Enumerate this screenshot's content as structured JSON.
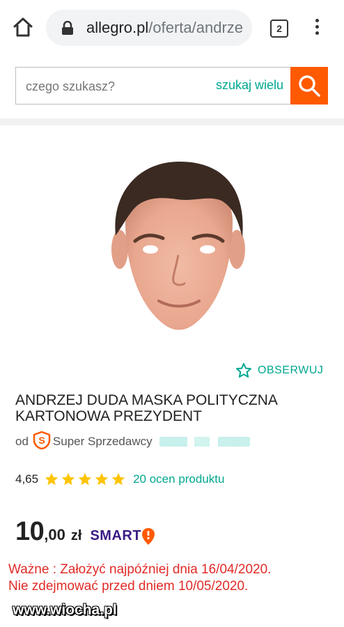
{
  "browser": {
    "url_domain": "allegro.pl",
    "url_path": "/oferta/andrze",
    "tab_count": "2"
  },
  "search": {
    "placeholder": "czego szukasz?",
    "search_many_label": "szukaj wielu"
  },
  "product": {
    "observe_label": "OBSERWUJ",
    "title": "ANDRZEJ DUDA MASKA POLITYCZNA KARTONOWA PREZYDENT",
    "seller_prefix": "od",
    "seller_label": "Super Sprzedawcy",
    "rating_value": "4,65",
    "rating_stars": 5,
    "rating_count_label": "20 ocen produktu",
    "price_main": "10",
    "price_cents": ",00",
    "price_currency": "zł",
    "smart_label": "SMART"
  },
  "notice": {
    "line1": "Ważne : Założyć najpóźniej dnia 16/04/2020.",
    "line2": "Nie zdejmować przed dniem 10/05/2020."
  },
  "watermark": "www.wiocha.pl",
  "colors": {
    "accent_orange": "#ff5a00",
    "link_teal": "#00a790",
    "star_yellow": "#ffc400",
    "notice_red": "#e02b27",
    "smart_purple": "#3a1b84"
  },
  "icons": [
    "home-icon",
    "lock-icon",
    "tab-switcher-icon",
    "more-vert-icon",
    "search-icon",
    "star-outline-icon",
    "super-seller-badge-icon",
    "star-icon",
    "smart-pin-icon"
  ]
}
